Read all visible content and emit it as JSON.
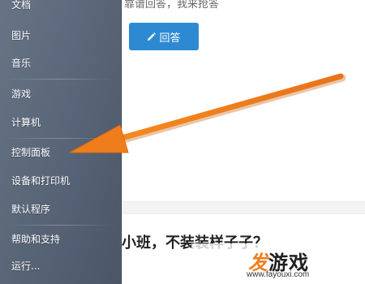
{
  "start_menu": {
    "items": [
      {
        "label": "文档"
      },
      {
        "label": "图片"
      },
      {
        "label": "音乐"
      },
      {
        "label": "游戏"
      },
      {
        "label": "计算机"
      },
      {
        "label": "控制面板"
      },
      {
        "label": "设备和打印机"
      },
      {
        "label": "默认程序"
      },
      {
        "label": "帮助和支持"
      },
      {
        "label": "运行..."
      }
    ]
  },
  "page": {
    "top_text": "靠谱回答，我来抢答",
    "answer_button_label": "回答",
    "question_title": "小班，不装装样子子？"
  },
  "watermark": {
    "logo_char_1": "发",
    "logo_rest": "游戏",
    "url": "www.fayouxi.com"
  },
  "colors": {
    "arrow": "#f07d1c",
    "button": "#2d8ad2",
    "menu_bg": "#5a687b"
  }
}
